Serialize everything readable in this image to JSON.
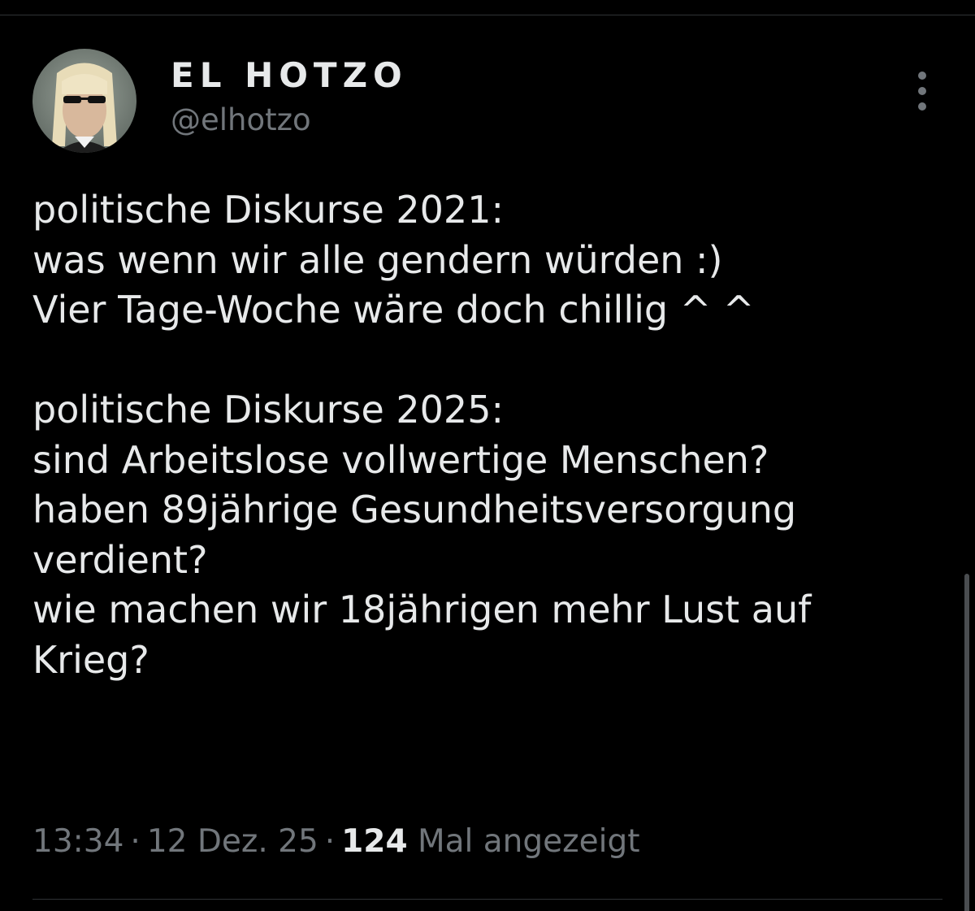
{
  "tweet": {
    "author": {
      "name": "EL HOTZO",
      "handle": "@elhotzo"
    },
    "text_lines": [
      "politische Diskurse 2021:",
      "was wenn wir alle gendern würden :)",
      "Vier Tage-Woche wäre doch chillig ^ ^",
      "",
      "politische Diskurse 2025:",
      "sind Arbeitslose vollwertige Menschen?",
      "haben 89jährige Gesundheitsversorgung",
      "verdient?",
      "wie machen wir 18jährigen mehr Lust auf",
      "Krieg?"
    ],
    "meta": {
      "time": "13:34",
      "separator": "·",
      "date": "12 Dez. 25",
      "views_count": "124",
      "views_label": "Mal angezeigt"
    },
    "more_icon": "more-vertical-icon"
  },
  "colors": {
    "background": "#000000",
    "text_primary": "#e7e9ea",
    "text_secondary": "#71767b",
    "divider": "#2f3336"
  }
}
